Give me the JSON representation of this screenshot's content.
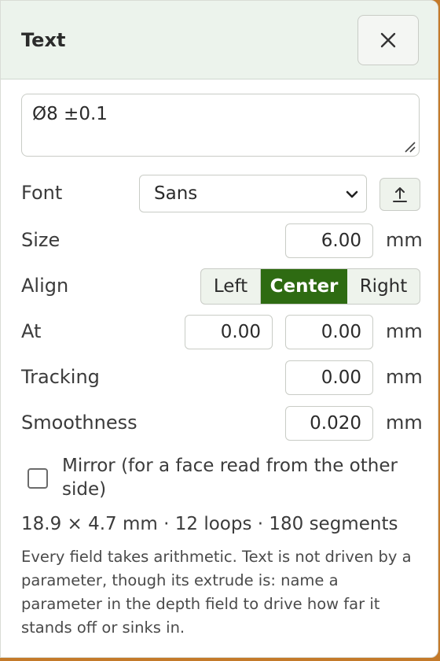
{
  "header": {
    "title": "Text",
    "close_icon": "close-icon"
  },
  "text_input": {
    "value": "Ø8 ±0.1"
  },
  "font": {
    "label": "Font",
    "selected": "Sans",
    "upload_icon": "upload-icon"
  },
  "size": {
    "label": "Size",
    "value": "6.00",
    "unit": "mm"
  },
  "align": {
    "label": "Align",
    "options": [
      "Left",
      "Center",
      "Right"
    ],
    "selected": "Center"
  },
  "at": {
    "label": "At",
    "x": "0.00",
    "y": "0.00",
    "unit": "mm"
  },
  "tracking": {
    "label": "Tracking",
    "value": "0.00",
    "unit": "mm"
  },
  "smoothness": {
    "label": "Smoothness",
    "value": "0.020",
    "unit": "mm"
  },
  "mirror": {
    "label": "Mirror (for a face read from the other side)",
    "checked": false
  },
  "stats": "18.9 × 4.7 mm · 12 loops · 180 segments",
  "help": "Every field takes arithmetic. Text is not driven by a parameter, though its extrude is: name a parameter in the depth field to drive how far it stands off or sinks in.",
  "colors": {
    "accent": "#2e6b12",
    "header_bg": "#ecf3ec"
  }
}
